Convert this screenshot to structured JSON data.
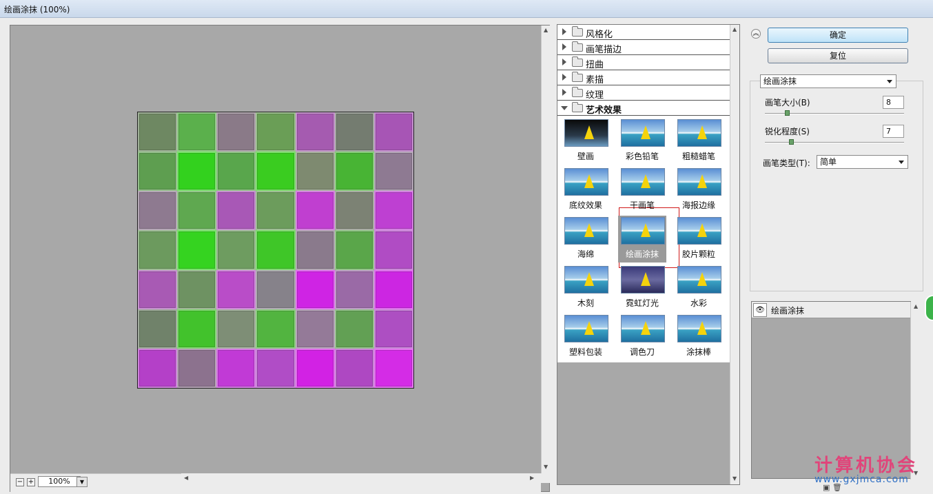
{
  "window": {
    "title": "绘画涂抹 (100%)"
  },
  "preview": {
    "zoom_level": "100%",
    "grid_rows": [
      [
        "#6e8862",
        "#5bb04c",
        "#8a7a88",
        "#6a9e56",
        "#a55bb0",
        "#747c70",
        "#a755b5"
      ],
      [
        "#5e9e50",
        "#33d11e",
        "#59a64c",
        "#3acc20",
        "#7e8a70",
        "#48b434",
        "#8e7a92"
      ],
      [
        "#8e7a90",
        "#5fa850",
        "#a858b6",
        "#6c9c5c",
        "#c03fd0",
        "#7c8274",
        "#be40d2"
      ],
      [
        "#6c9a5e",
        "#35d320",
        "#6e9c60",
        "#3fc628",
        "#8a7a8c",
        "#5aa64a",
        "#b04cc4"
      ],
      [
        "#a85ab4",
        "#6e9262",
        "#b94dc8",
        "#86828a",
        "#cf24e4",
        "#9a6aa6",
        "#cc26e2"
      ],
      [
        "#70826a",
        "#42c22c",
        "#7e8e76",
        "#52b440",
        "#947a98",
        "#62a054",
        "#ad4fc2"
      ],
      [
        "#b440c8",
        "#8c728e",
        "#c13ad6",
        "#b04dc6",
        "#d222e4",
        "#ae48c2",
        "#d42ce6"
      ]
    ]
  },
  "gallery": {
    "categories": [
      {
        "label": "风格化",
        "expanded": false
      },
      {
        "label": "画笔描边",
        "expanded": false
      },
      {
        "label": "扭曲",
        "expanded": false
      },
      {
        "label": "素描",
        "expanded": false
      },
      {
        "label": "纹理",
        "expanded": false
      },
      {
        "label": "艺术效果",
        "expanded": true
      }
    ],
    "filters": [
      "壁画",
      "彩色铅笔",
      "粗糙蜡笔",
      "底纹效果",
      "干画笔",
      "海报边缘",
      "海绵",
      "绘画涂抹",
      "胶片颗粒",
      "木刻",
      "霓虹灯光",
      "水彩",
      "塑料包装",
      "调色刀",
      "涂抹棒"
    ],
    "selected_filter": "绘画涂抹"
  },
  "actions": {
    "ok_label": "确定",
    "reset_label": "复位"
  },
  "settings": {
    "filter_select": "绘画涂抹",
    "brush_size_label": "画笔大小(B)",
    "brush_size_value": "8",
    "brush_size_fraction": 0.16,
    "sharpness_label": "锐化程度(S)",
    "sharpness_value": "7",
    "sharpness_fraction": 0.19,
    "brush_type_label": "画笔类型(T):",
    "brush_type_value": "简单"
  },
  "layers": {
    "items": [
      {
        "label": "绘画涂抹",
        "visible": true
      }
    ]
  },
  "watermark": {
    "text": "计算机协会",
    "url": "www.gxjmca.com"
  },
  "icons": [
    "folder-icon",
    "expand-triangle-icon",
    "eye-icon",
    "zoom-in-icon",
    "zoom-out-icon",
    "collapse-panel-icon",
    "dropdown-caret-icon"
  ]
}
